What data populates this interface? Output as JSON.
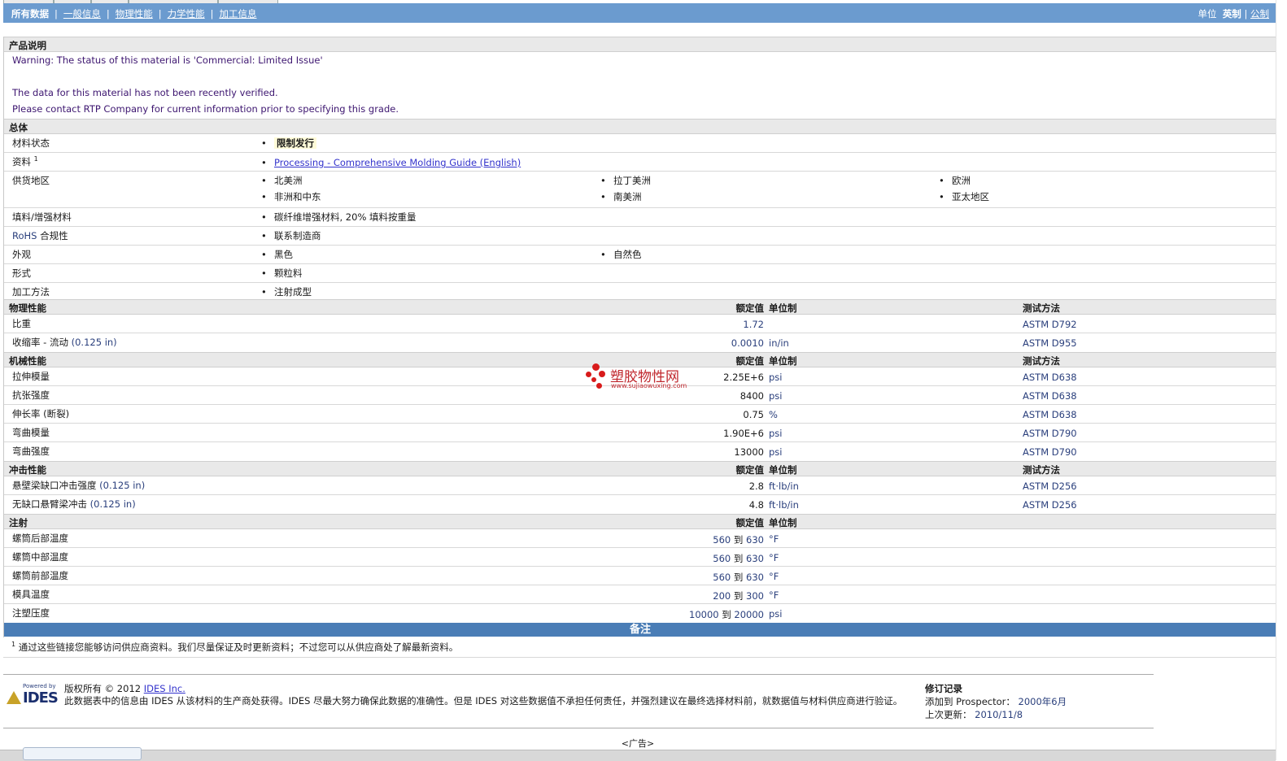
{
  "nav": {
    "tabs": [
      "所有数据",
      "一般信息",
      "物理性能",
      "力学性能",
      "加工信息"
    ],
    "unit_label": "单位",
    "unit_english": "英制",
    "unit_metric": "公制"
  },
  "product": {
    "title": "产品说明",
    "warning": "Warning: The status of this material is 'Commercial: Limited Issue'",
    "not_verified": "The data for this material has not been recently verified.",
    "contact": "Please contact RTP Company for current information prior to specifying this grade."
  },
  "general": {
    "title": "总体",
    "status_label": "材料状态",
    "status_value": "限制发行",
    "literature_label": "资料",
    "literature_sup": "1",
    "literature_link": "Processing - Comprehensive Molding Guide (English)",
    "regions_label": "供货地区",
    "regions": [
      "北美洲",
      "拉丁美洲",
      "欧洲",
      "非洲和中东",
      "南美洲",
      "亚太地区"
    ],
    "filler_label": "填料/增强材料",
    "filler_value": "碳纤维增强材料, 20% 填料按重量",
    "rohs_label_a": "RoHS",
    "rohs_label_b": "合规性",
    "rohs_value": "联系制造商",
    "appearance_label": "外观",
    "appearance": [
      "黑色",
      "自然色"
    ],
    "form_label": "形式",
    "form_value": "颗粒料",
    "method_label": "加工方法",
    "method_value": "注射成型"
  },
  "columns": {
    "nominal": "额定值",
    "unit": "单位制",
    "test": "测试方法"
  },
  "physical": {
    "title": "物理性能",
    "rows": [
      {
        "name": "比重",
        "cond": "",
        "value": "1.72",
        "unit": "",
        "test": "ASTM D792"
      },
      {
        "name": "收缩率 - 流动",
        "cond": "(0.125 in)",
        "value": "0.0010",
        "unit": "in/in",
        "test": "ASTM D955"
      }
    ]
  },
  "mechanical": {
    "title": "机械性能",
    "rows": [
      {
        "name": "拉伸模量",
        "cond": "",
        "value": "2.25E+6",
        "unit": "psi",
        "test": "ASTM D638"
      },
      {
        "name": "抗张强度",
        "cond": "",
        "value": "8400",
        "unit": "psi",
        "test": "ASTM D638"
      },
      {
        "name": "伸长率 (断裂)",
        "cond": "",
        "value": "0.75",
        "unit": "%",
        "test": "ASTM D638"
      },
      {
        "name": "弯曲模量",
        "cond": "",
        "value": "1.90E+6",
        "unit": "psi",
        "test": "ASTM D790"
      },
      {
        "name": "弯曲强度",
        "cond": "",
        "value": "13000",
        "unit": "psi",
        "test": "ASTM D790"
      }
    ]
  },
  "impact": {
    "title": "冲击性能",
    "rows": [
      {
        "name": "悬壁梁缺口冲击强度",
        "cond": "(0.125 in)",
        "value": "2.8",
        "unit": "ft·lb/in",
        "test": "ASTM D256"
      },
      {
        "name": "无缺口悬臂梁冲击",
        "cond": "(0.125 in)",
        "value": "4.8",
        "unit": "ft·lb/in",
        "test": "ASTM D256"
      }
    ]
  },
  "injection": {
    "title": "注射",
    "to": "到",
    "rows": [
      {
        "name": "螺筒后部温度",
        "low": "560",
        "high": "630",
        "unit": "°F"
      },
      {
        "name": "螺筒中部温度",
        "low": "560",
        "high": "630",
        "unit": "°F"
      },
      {
        "name": "螺筒前部温度",
        "low": "560",
        "high": "630",
        "unit": "°F"
      },
      {
        "name": "模具温度",
        "low": "200",
        "high": "300",
        "unit": "°F"
      },
      {
        "name": "注塑压度",
        "low": "10000",
        "high": "20000",
        "unit": "psi"
      }
    ]
  },
  "notes": {
    "title": "备注",
    "sup": "1",
    "text": "通过这些链接您能够访问供应商资料。我们尽量保证及时更新资料；不过您可以从供应商处了解最新资料。"
  },
  "watermark": {
    "name": "塑胶物性网",
    "url": "www.sujiaowuxing.com"
  },
  "footer": {
    "powered_by": "Powered by",
    "ides_logo": "IDES",
    "copyright_prefix": "版权所有 © 2012",
    "copyright_link": "IDES Inc.",
    "disclaimer": "此数据表中的信息由 IDES 从该材料的生产商处获得。IDES 尽最大努力确保此数据的准确性。但是 IDES 对这些数据值不承担任何责任，并强烈建议在最终选择材料前，就数据值与材料供应商进行验证。",
    "revision_title": "修订记录",
    "added_label": "添加到 Prospector：",
    "added_value": "2000年6月",
    "updated_label": "上次更新：",
    "updated_value": "2010/11/8",
    "ad": "<广告>"
  },
  "colors": {
    "nav_bar": "#6b9bcf",
    "notes_bar": "#4a7db6",
    "section_header": "#e9e9e9",
    "label_purple": "#3d1670",
    "link_blue": "#3333cc",
    "watermark_red": "#d81b1b"
  }
}
